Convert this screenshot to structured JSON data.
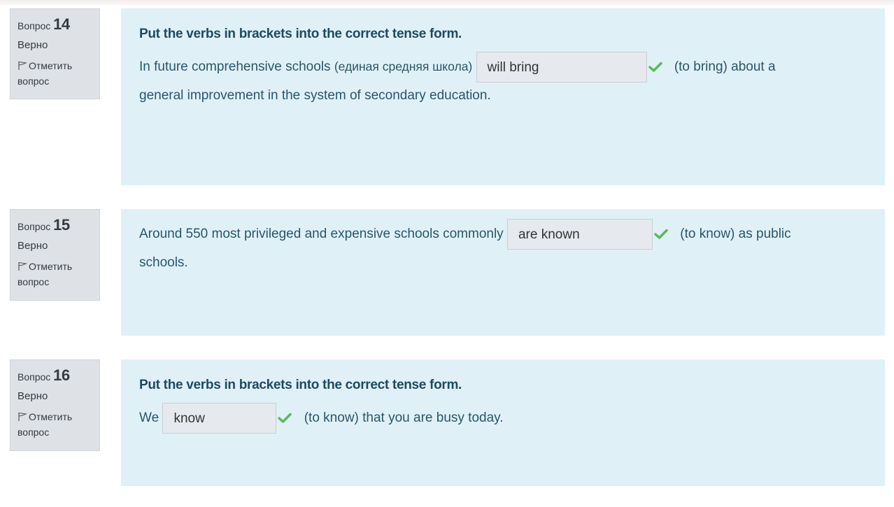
{
  "questions": [
    {
      "number_label": "Вопрос",
      "number": "14",
      "state": "Верно",
      "flag_label": "Отметить вопрос",
      "title": "Put the verbs in brackets into the correct tense form.",
      "text_before": "In future comprehensive schools",
      "text_ru": "(единая средняя школа)",
      "answer": "will bring",
      "text_after_1": "(to bring) about  a",
      "text_after_2": "general   improvement  in the system of secondary education."
    },
    {
      "number_label": "Вопрос",
      "number": "15",
      "state": "Верно",
      "flag_label": "Отметить вопрос",
      "title": "",
      "text_before": "Around 550 most privileged and expensive schools commonly",
      "answer": "are known",
      "text_after_1": "(to know) as public",
      "text_after_2": "schools."
    },
    {
      "number_label": "Вопрос",
      "number": "16",
      "state": "Верно",
      "flag_label": "Отметить вопрос",
      "title": "Put the verbs in brackets into the correct tense form.",
      "text_before": "We",
      "answer": "know",
      "text_after_1": "(to know) that you are busy today."
    }
  ],
  "colors": {
    "content_bg": "#dff1f7",
    "info_bg": "#dee2e6",
    "check": "#5cb85c"
  }
}
